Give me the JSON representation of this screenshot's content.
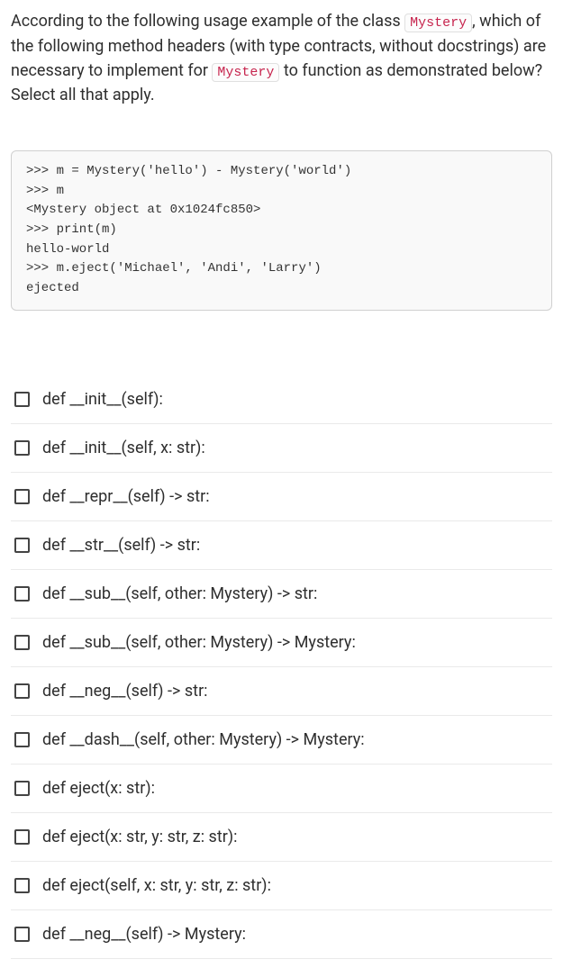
{
  "question": {
    "seg1": "According to the following usage example of the class ",
    "code1": "Mystery",
    "seg2": ", which of the following method headers (with type contracts, without docstrings) are necessary to implement for ",
    "code2": "Mystery",
    "seg3": " to function as demonstrated below? Select all that apply."
  },
  "code_block": ">>> m = Mystery('hello') - Mystery('world')\n>>> m\n<Mystery object at 0x1024fc850>\n>>> print(m)\nhello-world\n>>> m.eject('Michael', 'Andi', 'Larry')\nejected",
  "options": [
    "def __init__(self):",
    "def __init__(self, x: str):",
    "def __repr__(self) -> str:",
    "def __str__(self) -> str:",
    "def __sub__(self, other: Mystery) -> str:",
    "def __sub__(self, other: Mystery) -> Mystery:",
    "def __neg__(self) -> str:",
    "def __dash__(self, other: Mystery) -> Mystery:",
    "def eject(x: str):",
    "def eject(x: str, y: str, z: str):",
    "def eject(self, x: str, y: str, z: str):",
    "def __neg__(self) -> Mystery:"
  ]
}
